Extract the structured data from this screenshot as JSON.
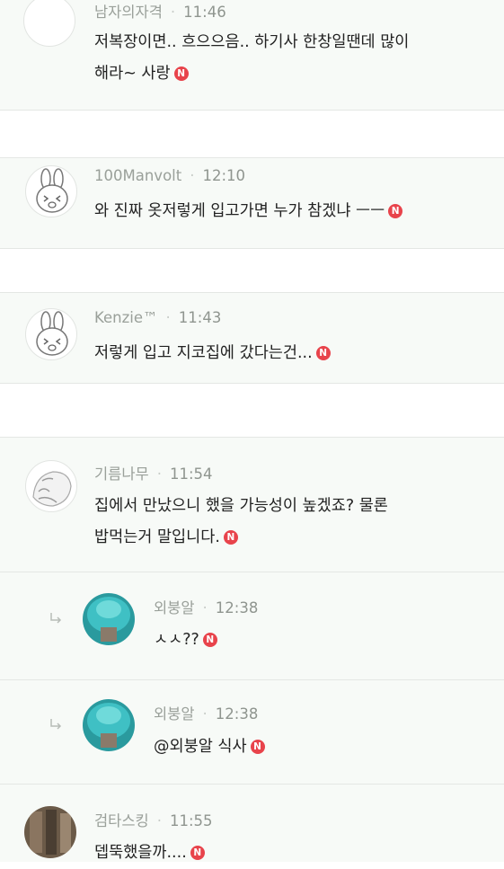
{
  "comments": [
    {
      "author": "남자의자격",
      "time": "11:46",
      "text1": "저복장이면.. 흐으으음.. 하기사 한창일땐데 많이",
      "text2": "해라~ 사랑",
      "badge": "N",
      "avatar_icon": "blank-avatar-icon"
    },
    {
      "author": "100Manvolt",
      "time": "12:10",
      "text1": "와 진짜 옷저렇게 입고가면 누가 참겠냐 ㅡㅡ",
      "badge": "N",
      "avatar_icon": "bunny-avatar-icon"
    },
    {
      "author": "Kenzie™",
      "time": "11:43",
      "text1": "저렇게 입고 지코집에 갔다는건...",
      "badge": "N",
      "avatar_icon": "bunny-avatar-icon"
    },
    {
      "author": "기름나무",
      "time": "11:54",
      "text1": "집에서 만났으니 했을 가능성이 높겠죠? 물론",
      "text2": "밥먹는거 말입니다.",
      "badge": "N",
      "avatar_icon": "sticker-avatar-icon",
      "replies": [
        {
          "author": "외붕알",
          "time": "12:38",
          "text1": "ㅅㅅ??",
          "badge": "N",
          "avatar_icon": "photo-avatar-icon"
        },
        {
          "author": "외붕알",
          "time": "12:38",
          "text1": "@외붕알  식사",
          "badge": "N",
          "avatar_icon": "photo-avatar-icon"
        }
      ]
    },
    {
      "author": "검타스킹",
      "time": "11:55",
      "text1": "뎁뚝했을까....",
      "badge": "N",
      "avatar_icon": "photo-avatar-icon"
    }
  ],
  "colors": {
    "badge": "#e8434b",
    "block_bg": "#f7faf7",
    "meta": "#9aa09a",
    "text": "#222222"
  }
}
